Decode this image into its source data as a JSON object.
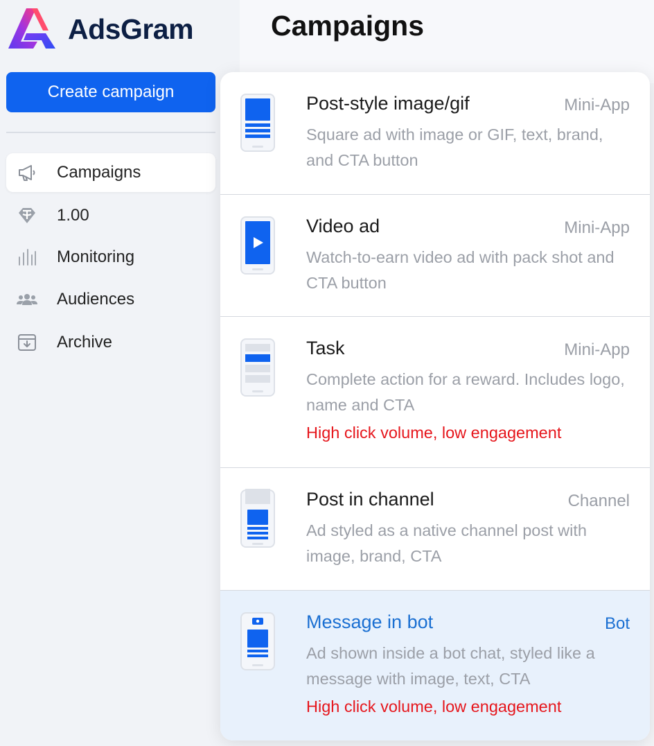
{
  "app": {
    "name": "AdsGram",
    "brand_color": "#0f63ef"
  },
  "sidebar": {
    "create_label": "Create campaign",
    "items": [
      {
        "label": "Campaigns",
        "icon": "megaphone-icon",
        "active": true
      },
      {
        "label": "1.00",
        "icon": "tether-icon",
        "active": false
      },
      {
        "label": "Monitoring",
        "icon": "bar-chart-icon",
        "active": false
      },
      {
        "label": "Audiences",
        "icon": "people-icon",
        "active": false
      },
      {
        "label": "Archive",
        "icon": "archive-icon",
        "active": false
      }
    ]
  },
  "header": {
    "title": "Campaigns"
  },
  "dropdown": {
    "options": [
      {
        "title": "Post-style image/gif",
        "tag": "Mini-App",
        "description": "Square ad with image or GIF, text, brand, and CTA button",
        "warning": ""
      },
      {
        "title": "Video ad",
        "tag": "Mini-App",
        "description": "Watch-to-earn video ad with pack shot and CTA button",
        "warning": ""
      },
      {
        "title": "Task",
        "tag": "Mini-App",
        "description": "Complete action for a reward. Includes logo, name and CTA",
        "warning": "High click volume, low engagement"
      },
      {
        "title": "Post in channel",
        "tag": "Channel",
        "description": "Ad styled as a native channel post with image, brand, CTA",
        "warning": ""
      },
      {
        "title": "Message in bot",
        "tag": "Bot",
        "description": "Ad shown inside a bot chat, styled like a message with image, text, CTA",
        "warning": "High click volume, low engagement",
        "highlighted": true
      }
    ],
    "warning_color": "#e6161c",
    "highlight_color": "#1a6fd2"
  }
}
